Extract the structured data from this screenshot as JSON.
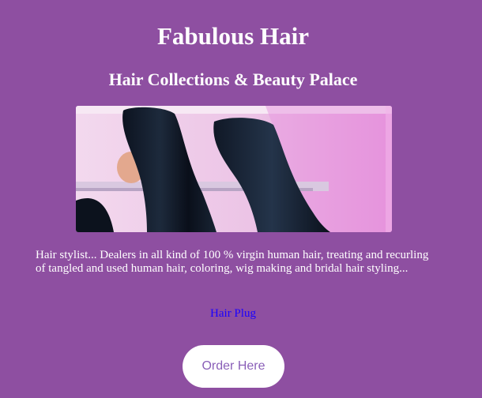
{
  "header": {
    "title": "Fabulous Hair",
    "subtitle": "Hair Collections & Beauty Palace"
  },
  "hero": {
    "image_subject": "straight-black-hair-wigs-on-display"
  },
  "main": {
    "description": "Hair stylist... Dealers in all kind of 100 % virgin human hair, treating and recurling of tangled and used human hair, coloring, wig making and bridal hair styling...",
    "link_label": "Hair Plug",
    "order_button_label": "Order Here"
  },
  "colors": {
    "background": "#8e4fa1",
    "text": "#ffffff",
    "link": "#1a00ff",
    "button_bg": "#ffffff",
    "button_text": "#8a5fb8"
  }
}
